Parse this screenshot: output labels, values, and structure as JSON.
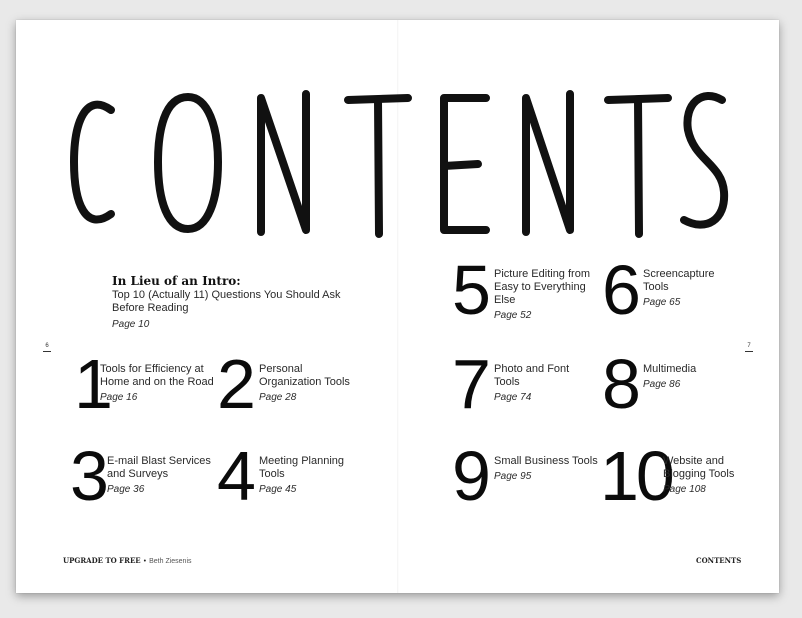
{
  "title": "CONTENTS",
  "intro": {
    "heading": "In Lieu of an Intro:",
    "text": "Top 10 (Actually 11) Questions You Should Ask Before Reading",
    "page": "Page 10"
  },
  "folios": {
    "left": "6",
    "right": "7"
  },
  "entries": [
    {
      "number": "1",
      "title": "Tools for Efficiency at Home and on the Road",
      "page": "Page 16"
    },
    {
      "number": "2",
      "title": "Personal Organization Tools",
      "page": "Page 28"
    },
    {
      "number": "3",
      "title": "E-mail Blast Services and Surveys",
      "page": "Page 36"
    },
    {
      "number": "4",
      "title": "Meeting Planning Tools",
      "page": "Page 45"
    },
    {
      "number": "5",
      "title": "Picture Editing from Easy to Everything Else",
      "page": "Page 52"
    },
    {
      "number": "6",
      "title": "Screencapture Tools",
      "page": "Page 65"
    },
    {
      "number": "7",
      "title": "Photo and Font Tools",
      "page": "Page 74"
    },
    {
      "number": "8",
      "title": "Multimedia",
      "page": "Page 86"
    },
    {
      "number": "9",
      "title": "Small Business Tools",
      "page": "Page 95"
    },
    {
      "number": "10",
      "title": "Website and Blogging Tools",
      "page": "Page 108"
    }
  ],
  "footer": {
    "brand": "UPGRADE TO FREE",
    "separator": "•",
    "author": "Beth Ziesenis",
    "section": "CONTENTS"
  }
}
